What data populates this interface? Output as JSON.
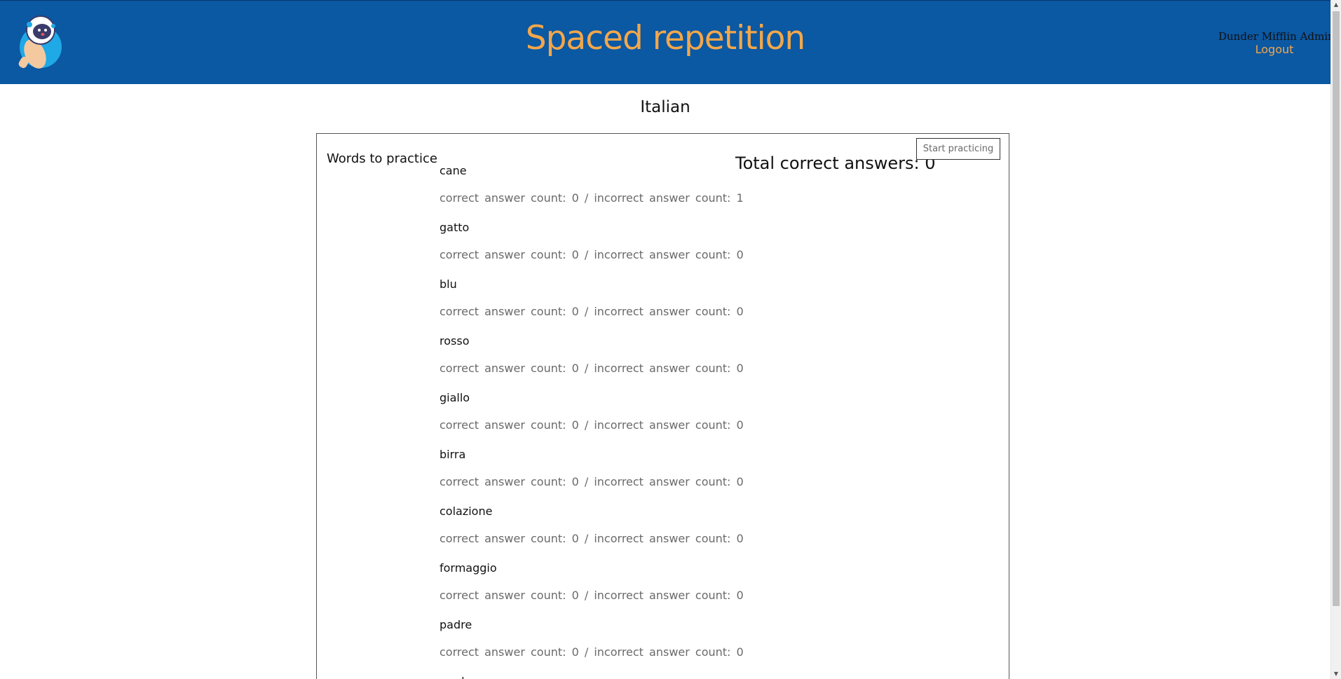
{
  "header": {
    "title": "Spaced repetition",
    "user_name": "Dunder Mifflin Admin",
    "logout_label": "Logout",
    "logo_icon": "astronaut-logo-icon",
    "background_color": "#0b58a3",
    "accent_color": "#f2a74b"
  },
  "main": {
    "language": "Italian",
    "words_heading": "Words to practice",
    "total_correct_label": "Total correct answers: 0",
    "start_button_label": "Start practicing",
    "words": [
      {
        "word": "cane",
        "stats": "correct answer count: 0 / incorrect answer count: 1"
      },
      {
        "word": "gatto",
        "stats": "correct answer count: 0 / incorrect answer count: 0"
      },
      {
        "word": "blu",
        "stats": "correct answer count: 0 / incorrect answer count: 0"
      },
      {
        "word": "rosso",
        "stats": "correct answer count: 0 / incorrect answer count: 0"
      },
      {
        "word": "giallo",
        "stats": "correct answer count: 0 / incorrect answer count: 0"
      },
      {
        "word": "birra",
        "stats": "correct answer count: 0 / incorrect answer count: 0"
      },
      {
        "word": "colazione",
        "stats": "correct answer count: 0 / incorrect answer count: 0"
      },
      {
        "word": "formaggio",
        "stats": "correct answer count: 0 / incorrect answer count: 0"
      },
      {
        "word": "padre",
        "stats": "correct answer count: 0 / incorrect answer count: 0"
      },
      {
        "word": "madre",
        "stats": ""
      }
    ]
  }
}
